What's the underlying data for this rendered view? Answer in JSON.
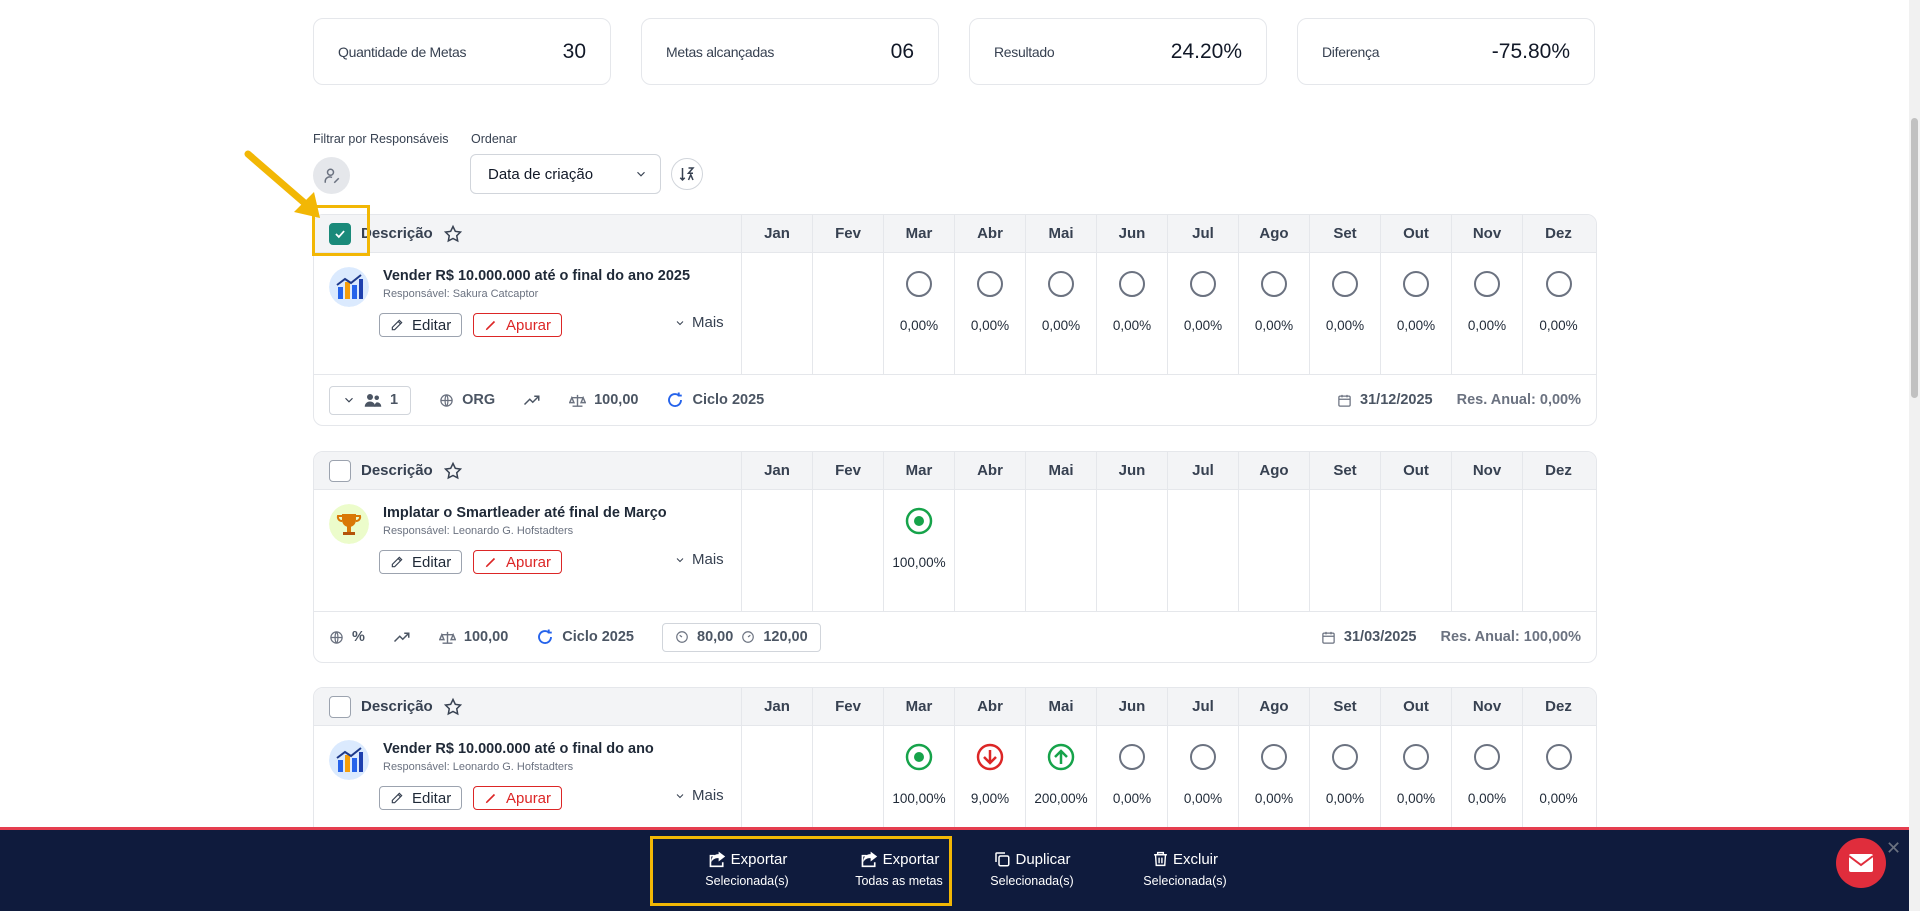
{
  "summary": [
    {
      "label": "Quantidade de Metas",
      "value": "30"
    },
    {
      "label": "Metas alcançadas",
      "value": "06"
    },
    {
      "label": "Resultado",
      "value": "24.20%"
    },
    {
      "label": "Diferença",
      "value": "-75.80%"
    }
  ],
  "filters": {
    "responsible_label": "Filtrar por Responsáveis",
    "order_label": "Ordenar",
    "order_value": "Data de criação"
  },
  "table_header": {
    "description": "Descrição",
    "months": [
      "Jan",
      "Fev",
      "Mar",
      "Abr",
      "Mai",
      "Jun",
      "Jul",
      "Ago",
      "Set",
      "Out",
      "Nov",
      "Dez"
    ]
  },
  "buttons": {
    "edit": "Editar",
    "apurar": "Apurar",
    "mais": "Mais"
  },
  "goals": [
    {
      "title": "Vender R$ 10.000.000 até o final do ano 2025",
      "responsible": "Responsável: Sakura Catcaptor",
      "months": [
        null,
        null,
        "0,00%",
        "0,00%",
        "0,00%",
        "0,00%",
        "0,00%",
        "0,00%",
        "0,00%",
        "0,00%",
        "0,00%",
        "0,00%"
      ],
      "footer": {
        "users": "1",
        "scope": "ORG",
        "weight": "100,00",
        "cycle": "Ciclo 2025",
        "date": "31/12/2025",
        "annual": "Res. Anual: 0,00%"
      }
    },
    {
      "title": "Implatar o Smartleader até final de Março",
      "responsible": "Responsável: Leonardo G. Hofstadters",
      "months": [
        null,
        null,
        "100,00%",
        null,
        null,
        null,
        null,
        null,
        null,
        null,
        null,
        null
      ],
      "footer": {
        "scope": "%",
        "weight": "100,00",
        "cycle": "Ciclo 2025",
        "min": "80,00",
        "max": "120,00",
        "date": "31/03/2025",
        "annual": "Res. Anual: 100,00%"
      }
    },
    {
      "title": "Vender R$ 10.000.000 até o final do ano",
      "responsible": "Responsável: Leonardo G. Hofstadters",
      "months": [
        null,
        null,
        "100,00%",
        "9,00%",
        "200,00%",
        "0,00%",
        "0,00%",
        "0,00%",
        "0,00%",
        "0,00%",
        "0,00%",
        "0,00%"
      ]
    }
  ],
  "actions": [
    {
      "main": "Exportar",
      "sub": "Selecionada(s)"
    },
    {
      "main": "Exportar",
      "sub": "Todas as metas"
    },
    {
      "main": "Duplicar",
      "sub": "Selecionada(s)"
    },
    {
      "main": "Excluir",
      "sub": "Selecionada(s)"
    }
  ],
  "colors": {
    "accent_teal": "#1a8a7a",
    "danger": "#dc2626",
    "success": "#16a34a",
    "bar_bg": "#0f1b3d",
    "highlight": "#f2b705"
  }
}
